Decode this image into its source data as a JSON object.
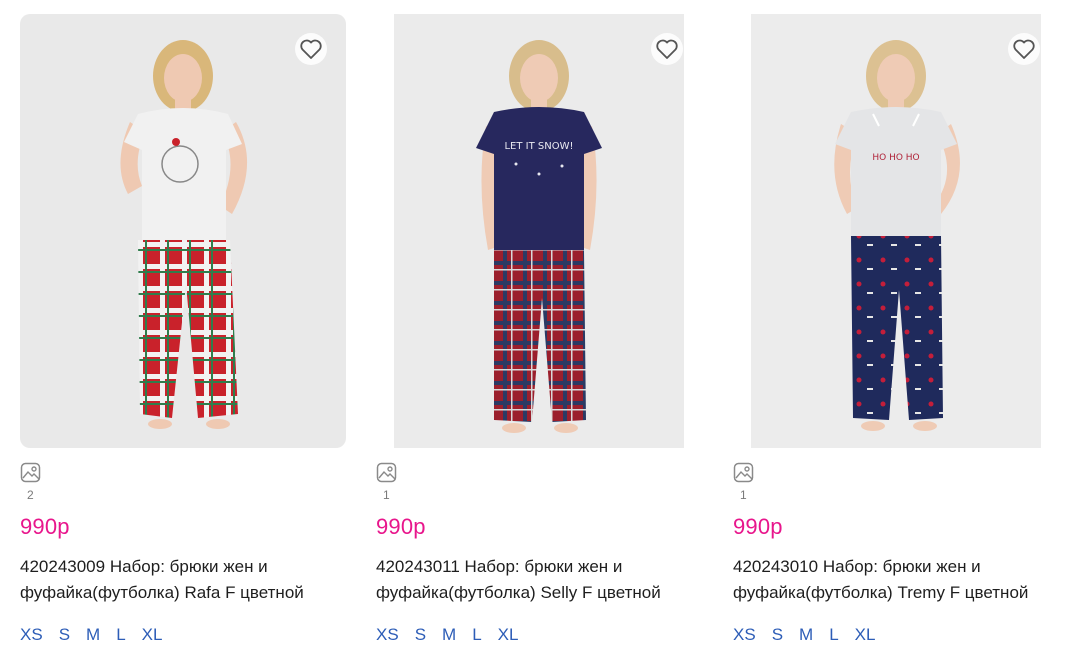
{
  "accent_price_color": "#e8168c",
  "size_link_color": "#2d5db7",
  "products": [
    {
      "favorite_icon": "heart-outline-icon",
      "gallery_icon": "image-icon",
      "photo_count": "2",
      "price": "990р",
      "title": "420243009 Набор: брюки жен и фуфайка(футболка) Rafa F цветной",
      "sizes": [
        "XS",
        "S",
        "M",
        "L",
        "XL"
      ]
    },
    {
      "favorite_icon": "heart-outline-icon",
      "gallery_icon": "image-icon",
      "photo_count": "1",
      "price": "990р",
      "title": "420243011 Набор: брюки жен и фуфайка(футболка) Selly F цветной",
      "sizes": [
        "XS",
        "S",
        "M",
        "L",
        "XL"
      ]
    },
    {
      "favorite_icon": "heart-outline-icon",
      "gallery_icon": "image-icon",
      "photo_count": "1",
      "price": "990р",
      "title": "420243010 Набор: брюки жен и фуфайка(футболка) Tremy F цветной",
      "sizes": [
        "XS",
        "S",
        "M",
        "L",
        "XL"
      ]
    }
  ]
}
